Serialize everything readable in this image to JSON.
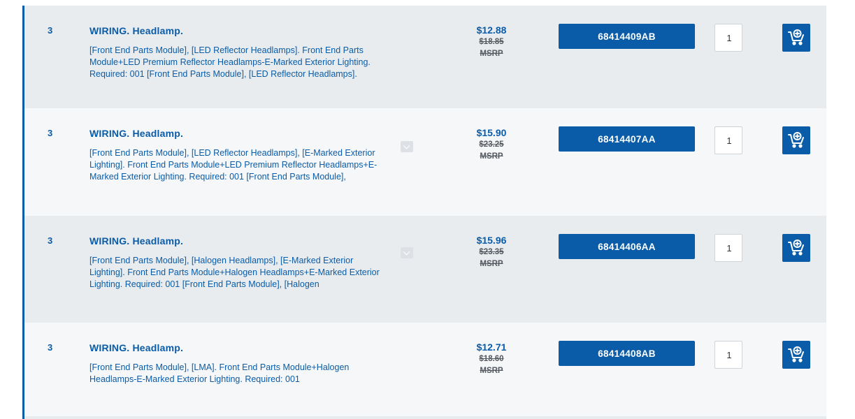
{
  "items": [
    {
      "ref_no": "3",
      "title": "WIRING. Headlamp.",
      "description": "[Front End Parts Module], [LED Reflector Headlamps]. Front End Parts Module+LED Premium Reflector Headlamps-E-Marked Exterior Lighting. Required: 001 [Front End Parts Module], [LED Reflector Headlamps].",
      "price": "$12.88",
      "original_price": "$18.85",
      "msrp_label": "MSRP",
      "part_number": "68414409AB",
      "quantity": "1",
      "cart_icon": "add-to-cart-icon"
    },
    {
      "ref_no": "3",
      "title": "WIRING. Headlamp.",
      "description": "[Front End Parts Module], [LED Reflector Headlamps], [E-Marked Exterior Lighting]. Front End Parts Module+LED Premium Reflector Headlamps+E-Marked Exterior Lighting. Required: 001 [Front End Parts Module],",
      "price": "$15.90",
      "original_price": "$23.25",
      "msrp_label": "MSRP",
      "part_number": "68414407AA",
      "quantity": "1",
      "cart_icon": "add-to-cart-icon",
      "expand_icon": "chevron-down-icon"
    },
    {
      "ref_no": "3",
      "title": "WIRING. Headlamp.",
      "description": "[Front End Parts Module], [Halogen Headlamps], [E-Marked Exterior Lighting]. Front End Parts Module+Halogen Headlamps+E-Marked Exterior Lighting. Required: 001 [Front End Parts Module], [Halogen",
      "price": "$15.96",
      "original_price": "$23.35",
      "msrp_label": "MSRP",
      "part_number": "68414406AA",
      "quantity": "1",
      "cart_icon": "add-to-cart-icon",
      "expand_icon": "chevron-down-icon"
    },
    {
      "ref_no": "3",
      "title": "WIRING. Headlamp.",
      "description": "[Front End Parts Module], [LMA]. Front End Parts Module+Halogen Headlamps-E-Marked Exterior Lighting. Required: 001",
      "price": "$12.71",
      "original_price": "$18.60",
      "msrp_label": "MSRP",
      "part_number": "68414408AB",
      "quantity": "1",
      "cart_icon": "add-to-cart-icon"
    }
  ],
  "colors": {
    "accent": "#0a5ca8",
    "row_shaded": "#e9ecee",
    "row_light": "#f5f7f9",
    "strike_text": "#555a60"
  }
}
